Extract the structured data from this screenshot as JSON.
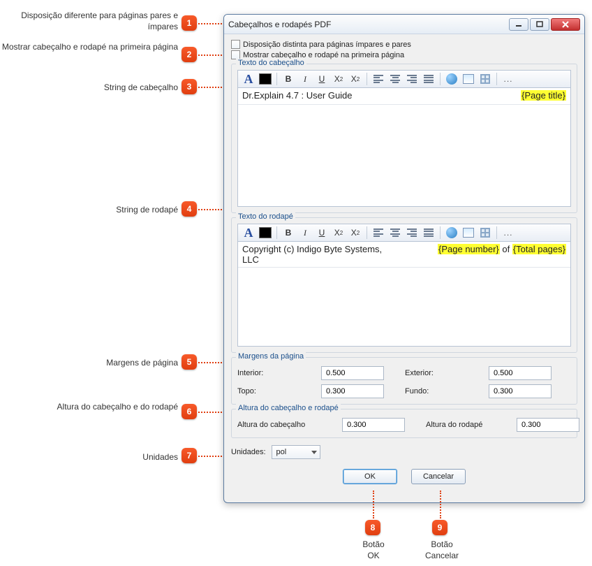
{
  "dialog": {
    "title": "Cabeçalhos e rodapés PDF",
    "checkbox1": "Disposição distinta para páginas ímpares e pares",
    "checkbox2": "Mostrar cabeçalho e rodapé na primeira página"
  },
  "header_group": {
    "title": "Texto do cabeçalho",
    "left_text": "Dr.Explain 4.7 : User Guide",
    "right_var": "{Page title}"
  },
  "footer_group": {
    "title": "Texto do rodapé",
    "left_text": "Copyright (c) Indigo Byte Systems, LLC",
    "right_var1": "{Page number}",
    "right_sep": " of ",
    "right_var2": "{Total pages}"
  },
  "toolbar": {
    "font": "A",
    "bold": "B",
    "italic": "I",
    "underline": "U",
    "sub": "X",
    "sub2": "2",
    "sup": "X",
    "sup2": "2",
    "more": "..."
  },
  "margins": {
    "title": "Margens da página",
    "interior_label": "Interior:",
    "interior_val": "0.500",
    "exterior_label": "Exterior:",
    "exterior_val": "0.500",
    "top_label": "Topo:",
    "top_val": "0.300",
    "bottom_label": "Fundo:",
    "bottom_val": "0.300"
  },
  "heights": {
    "title": "Altura do  cabeçalho e rodapé",
    "header_label": "Altura do cabeçalho",
    "header_val": "0.300",
    "footer_label": "Altura do rodapé",
    "footer_val": "0.300"
  },
  "units": {
    "label": "Unidades:",
    "value": "pol"
  },
  "buttons": {
    "ok": "OK",
    "cancel": "Cancelar"
  },
  "callouts": {
    "c1": "Disposição diferente para páginas pares e ímpares",
    "c2": "Mostrar cabeçalho e rodapé na primeira página",
    "c3": "String de cabeçalho",
    "c4": "String de rodapé",
    "c5": "Margens de página",
    "c6": "Altura do cabeçalho e do rodapé",
    "c7": "Unidades",
    "c8a": "Botão",
    "c8b": "OK",
    "c9a": "Botão",
    "c9b": "Cancelar",
    "n1": "1",
    "n2": "2",
    "n3": "3",
    "n4": "4",
    "n5": "5",
    "n6": "6",
    "n7": "7",
    "n8": "8",
    "n9": "9"
  }
}
